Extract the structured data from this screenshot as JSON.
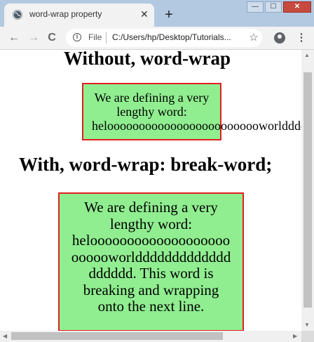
{
  "window": {
    "minimize_label": "—",
    "maximize_label": "☐",
    "close_label": "✕"
  },
  "tab": {
    "title": "word-wrap property",
    "close_label": "✕",
    "new_tab_label": "+"
  },
  "toolbar": {
    "back_label": "←",
    "forward_label": "→",
    "reload_label": "C",
    "info_label": "i",
    "scheme_label": "File",
    "url": "C:/Users/hp/Desktop/Tutorials...",
    "star_label": "☆",
    "menu_label": "⋮"
  },
  "page": {
    "heading1": "Without, word-wrap",
    "box1_lines": [
      "We are defining a very",
      "lengthy word:"
    ],
    "box1_overflow": "helooooooooooooooooooooooooworldddddddddddddddd",
    "heading2": "With, word-wrap: break-word;",
    "box2_lines": [
      "We are defining a very",
      "lengthy word:",
      "helooooooooooooooooooo",
      "oooooworlddddddddddddd",
      "dddddd. This word is",
      "breaking and wrapping",
      "onto the next line."
    ]
  },
  "colors": {
    "box_fill": "#90ee90",
    "box_border": "#e02020",
    "tab_strip": "#b3c9e2"
  }
}
